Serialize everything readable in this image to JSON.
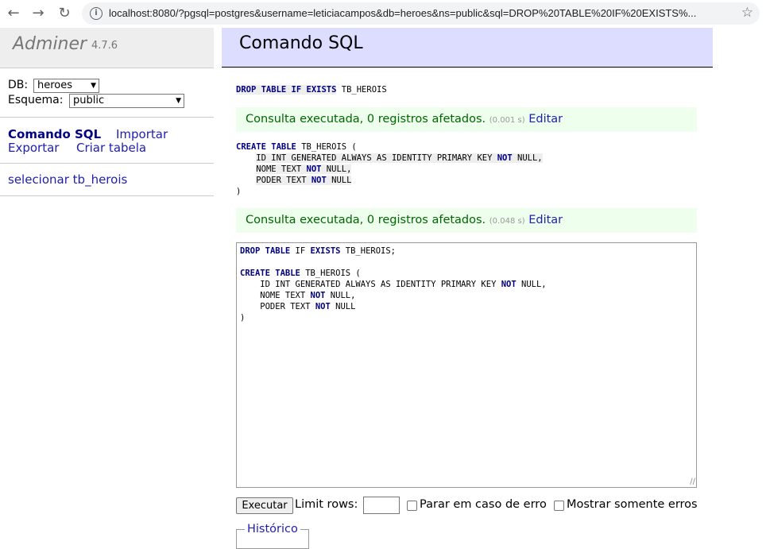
{
  "browser": {
    "url": "localhost:8080/?pgsql=postgres&username=leticiacampos&db=heroes&ns=public&sql=DROP%20TABLE%20IF%20EXISTS%..."
  },
  "menu": {
    "app_name": "Adminer",
    "version": "4.7.6",
    "db_label": "DB:",
    "db_value": "heroes",
    "schema_label": "Esquema:",
    "schema_value": "public",
    "links": {
      "sql_command": "Comando SQL",
      "import": "Importar",
      "export": "Exportar",
      "create_table": "Criar tabela"
    },
    "tables": [
      "selecionar tb_herois"
    ]
  },
  "content": {
    "title": "Comando SQL",
    "query1_prefix": "DROP TABLE IF EXISTS",
    "query1_rest": " TB_HEROIS",
    "result1": {
      "text": "Consulta executada, 0 registros afetados.",
      "time": "(0.001 s)",
      "edit": "Editar"
    },
    "result2": {
      "text": "Consulta executada, 0 registros afetados.",
      "time": "(0.048 s)",
      "edit": "Editar"
    },
    "bottom": {
      "execute": "Executar",
      "limit_rows": "Limit rows:",
      "stop_on_error": "Parar em caso de erro",
      "only_errors": "Mostrar somente erros",
      "history": "Histórico"
    }
  }
}
